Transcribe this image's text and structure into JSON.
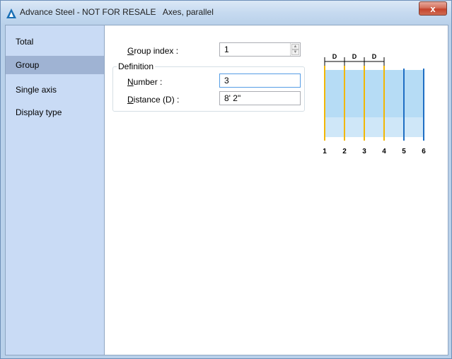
{
  "window": {
    "title": "Advance Steel - NOT FOR RESALE   Axes, parallel",
    "close_label": "x"
  },
  "sidebar": {
    "items": [
      {
        "label": "Total"
      },
      {
        "label": "Group"
      },
      {
        "label": "Single axis"
      },
      {
        "label": "Display type"
      }
    ],
    "active_index": 1
  },
  "form": {
    "group_index_label_prefix": "G",
    "group_index_label_rest": "roup index :",
    "group_index_value": "1",
    "definition_label": "Definition",
    "number_label_prefix": "N",
    "number_label_rest": "umber :",
    "number_value": "3",
    "distance_label_prefix": "D",
    "distance_label_rest": "istance (D) :",
    "distance_value": "8' 2\""
  },
  "preview": {
    "dimension_labels": [
      "D",
      "D",
      "D"
    ],
    "axis_labels": [
      "1",
      "2",
      "3",
      "4",
      "5",
      "6"
    ],
    "colors": {
      "fill": "#b6dcf5",
      "yellow_axis": "#f2b705",
      "blue_axis": "#1f6fc4"
    }
  }
}
